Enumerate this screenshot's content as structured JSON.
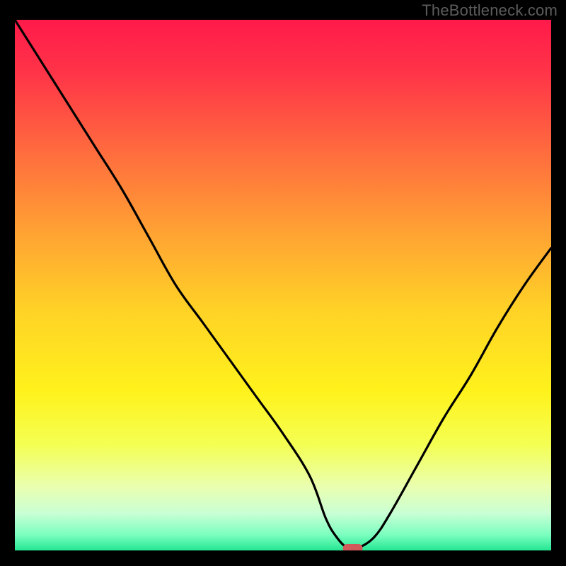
{
  "watermark": "TheBottleneck.com",
  "chart_data": {
    "type": "line",
    "title": "",
    "xlabel": "",
    "ylabel": "",
    "xlim": [
      0,
      100
    ],
    "ylim": [
      0,
      100
    ],
    "grid": false,
    "legend": false,
    "series": [
      {
        "name": "bottleneck-curve",
        "x": [
          0,
          5,
          10,
          15,
          20,
          25,
          30,
          35,
          40,
          45,
          50,
          55,
          58,
          60,
          62,
          64,
          67,
          70,
          75,
          80,
          85,
          90,
          95,
          100
        ],
        "y": [
          100,
          92,
          84,
          76,
          68,
          59,
          50,
          43,
          36,
          29,
          22,
          14,
          6,
          2.5,
          0.5,
          0.5,
          2.5,
          7,
          16,
          25,
          33,
          42,
          50,
          57
        ]
      }
    ],
    "marker": {
      "name": "optimal-point",
      "x": 63,
      "y": 0.4,
      "color": "#d25a5a"
    },
    "gradient_stops": [
      {
        "offset": 0.0,
        "color": "#ff1a4a"
      },
      {
        "offset": 0.1,
        "color": "#ff3448"
      },
      {
        "offset": 0.25,
        "color": "#ff6c3e"
      },
      {
        "offset": 0.4,
        "color": "#ffa233"
      },
      {
        "offset": 0.55,
        "color": "#ffd326"
      },
      {
        "offset": 0.7,
        "color": "#fff21c"
      },
      {
        "offset": 0.8,
        "color": "#f4ff52"
      },
      {
        "offset": 0.88,
        "color": "#eaffb0"
      },
      {
        "offset": 0.93,
        "color": "#c9ffd4"
      },
      {
        "offset": 0.97,
        "color": "#7cffc0"
      },
      {
        "offset": 1.0,
        "color": "#25e693"
      }
    ]
  }
}
